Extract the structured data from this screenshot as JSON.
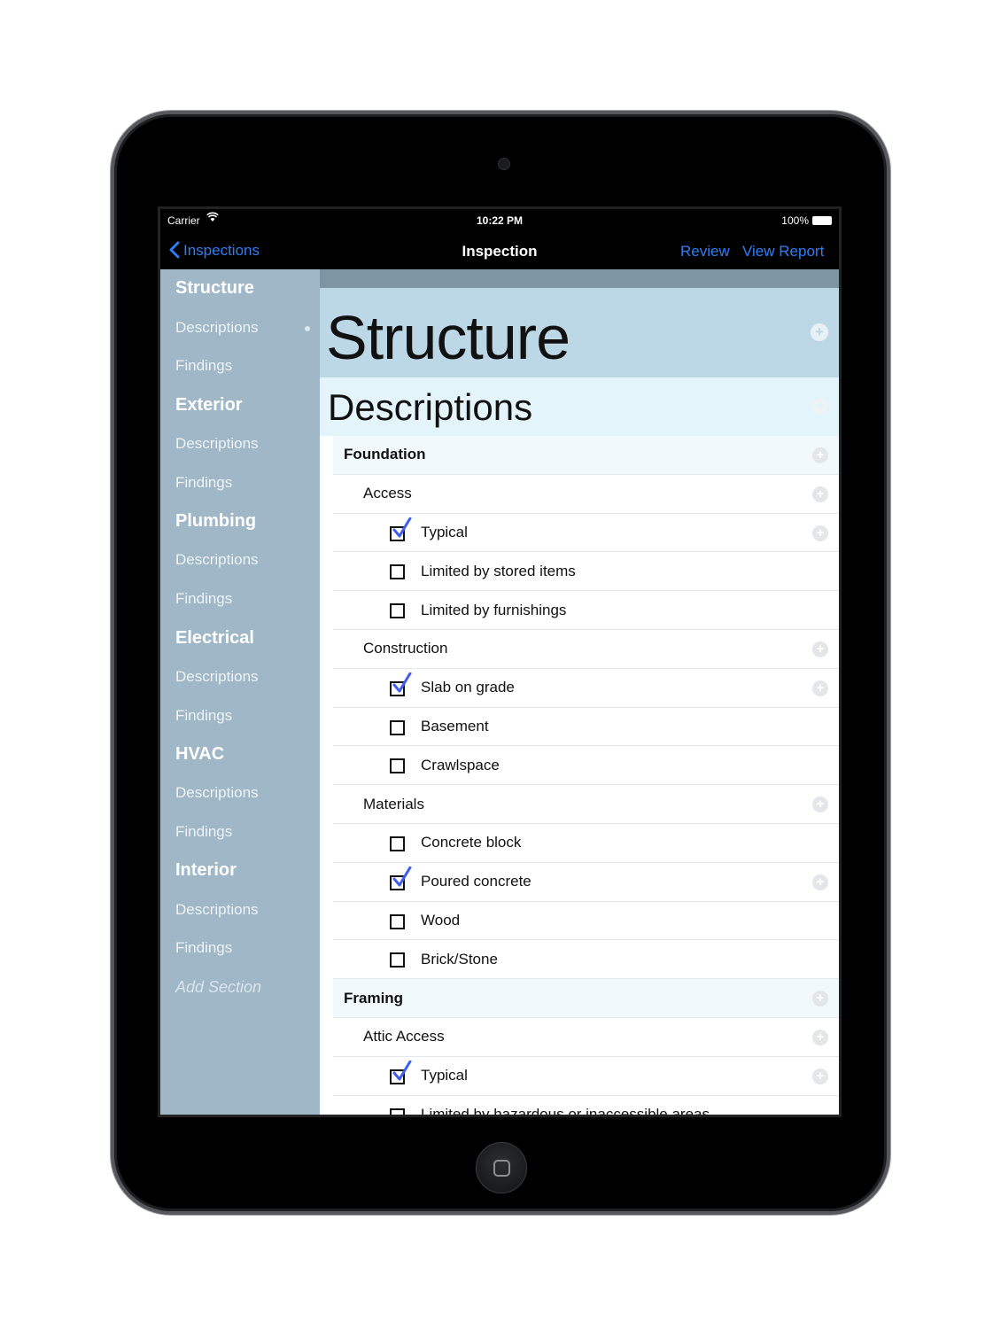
{
  "status": {
    "carrier": "Carrier",
    "time": "10:22 PM",
    "battery": "100%"
  },
  "nav": {
    "back": "Inspections",
    "title": "Inspection",
    "review": "Review",
    "report": "View Report"
  },
  "sidebar": {
    "items": [
      {
        "label": "Structure",
        "kind": "section"
      },
      {
        "label": "Descriptions",
        "kind": "sub",
        "active": true
      },
      {
        "label": "Findings",
        "kind": "sub"
      },
      {
        "label": "Exterior",
        "kind": "section"
      },
      {
        "label": "Descriptions",
        "kind": "sub"
      },
      {
        "label": "Findings",
        "kind": "sub"
      },
      {
        "label": "Plumbing",
        "kind": "section"
      },
      {
        "label": "Descriptions",
        "kind": "sub"
      },
      {
        "label": "Findings",
        "kind": "sub"
      },
      {
        "label": "Electrical",
        "kind": "section"
      },
      {
        "label": "Descriptions",
        "kind": "sub"
      },
      {
        "label": "Findings",
        "kind": "sub"
      },
      {
        "label": "HVAC",
        "kind": "section"
      },
      {
        "label": "Descriptions",
        "kind": "sub"
      },
      {
        "label": "Findings",
        "kind": "sub"
      },
      {
        "label": "Interior",
        "kind": "section"
      },
      {
        "label": "Descriptions",
        "kind": "sub"
      },
      {
        "label": "Findings",
        "kind": "sub"
      }
    ],
    "add_section": "Add Section"
  },
  "main": {
    "title": "Structure",
    "subtitle": "Descriptions",
    "rows": [
      {
        "kind": "group",
        "label": "Foundation"
      },
      {
        "kind": "sub",
        "label": "Access"
      },
      {
        "kind": "item",
        "label": "Typical",
        "checked": true
      },
      {
        "kind": "item",
        "label": "Limited by stored items",
        "checked": false
      },
      {
        "kind": "item",
        "label": "Limited by furnishings",
        "checked": false
      },
      {
        "kind": "sub",
        "label": "Construction"
      },
      {
        "kind": "item",
        "label": "Slab on grade",
        "checked": true
      },
      {
        "kind": "item",
        "label": "Basement",
        "checked": false
      },
      {
        "kind": "item",
        "label": "Crawlspace",
        "checked": false
      },
      {
        "kind": "sub",
        "label": "Materials"
      },
      {
        "kind": "item",
        "label": "Concrete block",
        "checked": false
      },
      {
        "kind": "item",
        "label": "Poured concrete",
        "checked": true
      },
      {
        "kind": "item",
        "label": "Wood",
        "checked": false
      },
      {
        "kind": "item",
        "label": "Brick/Stone",
        "checked": false
      },
      {
        "kind": "group",
        "label": "Framing"
      },
      {
        "kind": "sub",
        "label": "Attic Access"
      },
      {
        "kind": "item",
        "label": "Typical",
        "checked": true
      },
      {
        "kind": "item",
        "label": "Limited by hazardous or inaccessible areas",
        "checked": false
      }
    ]
  },
  "colors": {
    "accent": "#2f7df6",
    "sidebar": "#9fb7c6",
    "header": "#bcd8e7",
    "subheader": "#e4f4fb",
    "check": "#3d5ef0"
  }
}
